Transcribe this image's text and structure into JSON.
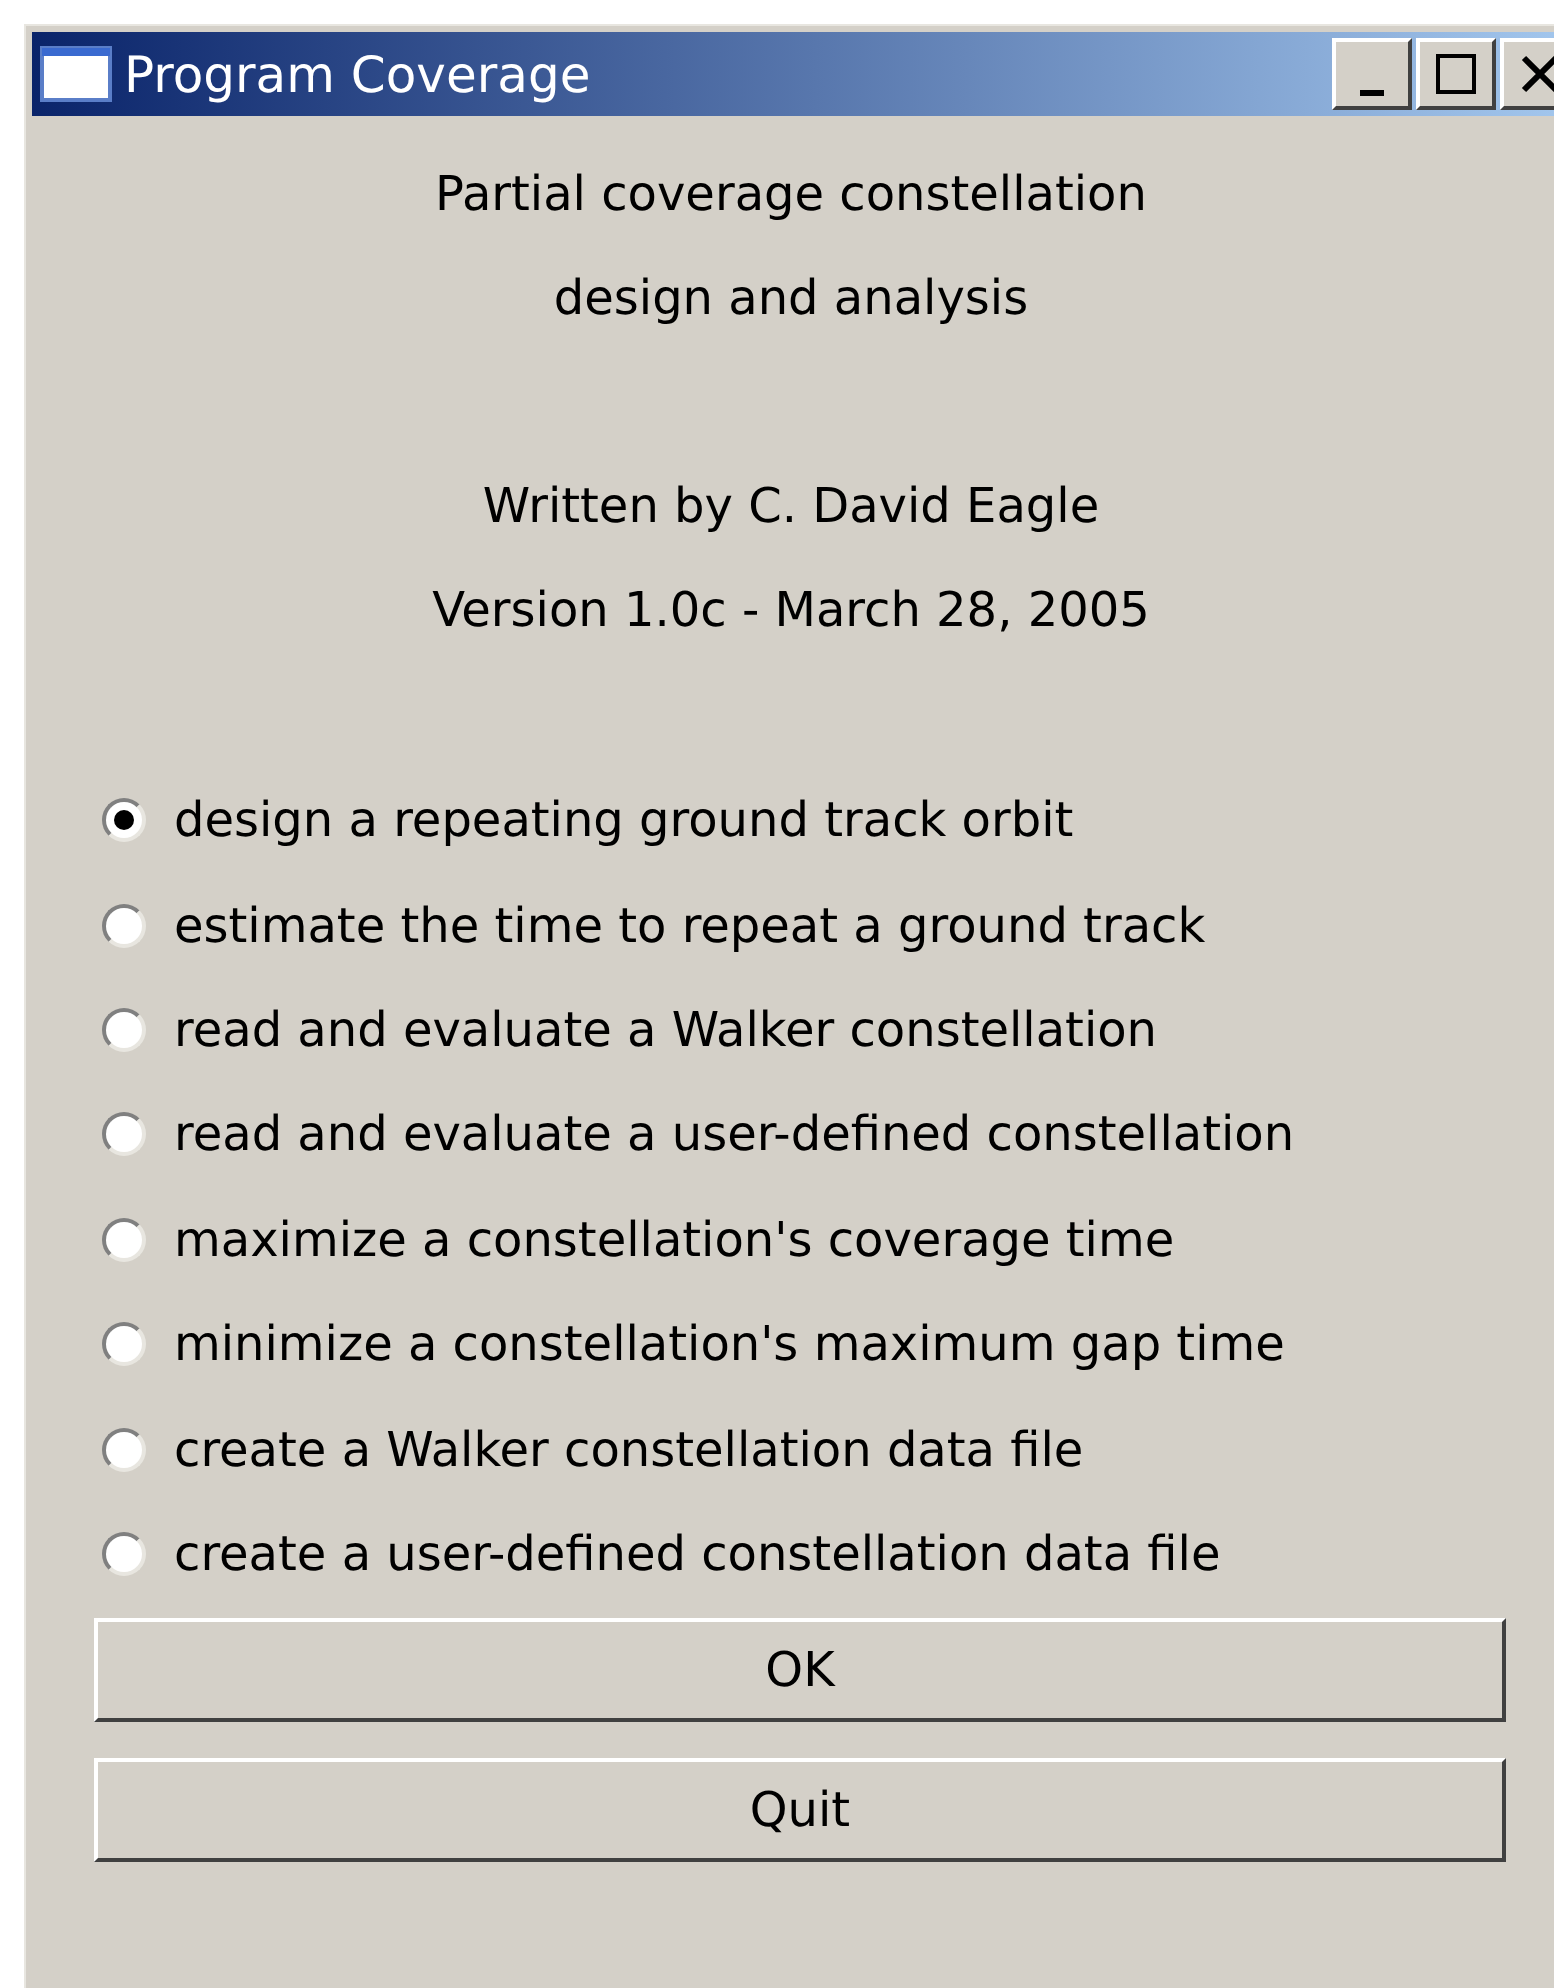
{
  "window": {
    "title": "Program Coverage"
  },
  "header_lines": [
    "Partial coverage constellation",
    "design and analysis"
  ],
  "credit_lines": [
    "Written by C. David Eagle",
    "Version 1.0c - March 28, 2005"
  ],
  "options": [
    {
      "label": "design a repeating ground track orbit",
      "selected": true
    },
    {
      "label": "estimate the time to repeat a ground track",
      "selected": false
    },
    {
      "label": "read and evaluate a Walker constellation",
      "selected": false
    },
    {
      "label": "read and evaluate a user-defined constellation",
      "selected": false
    },
    {
      "label": "maximize a constellation's coverage time",
      "selected": false
    },
    {
      "label": "minimize a constellation's maximum gap time",
      "selected": false
    },
    {
      "label": "create a Walker constellation data file",
      "selected": false
    },
    {
      "label": "create a user-defined constellation data file",
      "selected": false
    }
  ],
  "buttons": [
    "OK",
    "Quit"
  ]
}
